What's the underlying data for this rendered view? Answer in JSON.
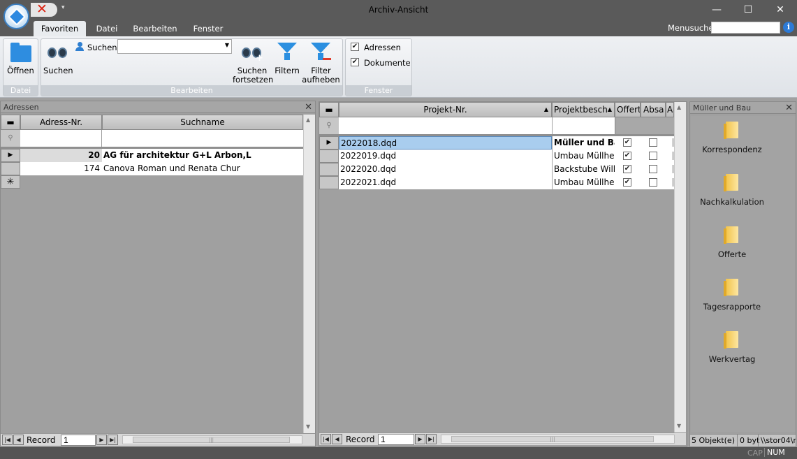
{
  "window": {
    "title": "Archiv-Ansicht",
    "minimize": "—",
    "maximize": "☐",
    "close": "✕"
  },
  "tabs": [
    {
      "label": "Favoriten",
      "active": true
    },
    {
      "label": "Datei"
    },
    {
      "label": "Bearbeiten"
    },
    {
      "label": "Fenster"
    }
  ],
  "menusuche": {
    "label": "Menusuche",
    "value": ""
  },
  "ribbon": {
    "groups": {
      "datei": "Datei",
      "bearbeiten": "Bearbeiten",
      "fenster": "Fenster"
    },
    "oeffnen": "Öffnen",
    "suchen": "Suchen",
    "suchen_field_label": "Suchen",
    "suchen_field_value": "",
    "suchen_fortsetzen_1": "Suchen",
    "suchen_fortsetzen_2": "fortsetzen",
    "filtern": "Filtern",
    "filter_aufheben_1": "Filter",
    "filter_aufheben_2": "aufheben",
    "chk_adressen": {
      "label": "Adressen",
      "checked": true
    },
    "chk_dokumente": {
      "label": "Dokumente",
      "checked": true
    }
  },
  "adressen_panel": {
    "title": "Adressen",
    "columns": [
      "Adress-Nr.",
      "Suchname"
    ],
    "rows": [
      {
        "nr": "20",
        "name": "AG für architektur G+L Arbon,L",
        "current": true
      },
      {
        "nr": "174",
        "name": "Canova Roman und Renata Chur",
        "current": false
      }
    ],
    "nav": {
      "record_label": "Record",
      "record_value": "1"
    }
  },
  "projekte_panel": {
    "columns": [
      "Projekt-Nr.",
      "Projektbesch",
      "Offert",
      "Absa",
      "A"
    ],
    "rows": [
      {
        "nr": "2022018.dqd",
        "desc": "Müller und Ba",
        "offert": true,
        "absa": false,
        "current": true
      },
      {
        "nr": "2022019.dqd",
        "desc": "Umbau Müllhei",
        "offert": true,
        "absa": false
      },
      {
        "nr": "2022020.dqd",
        "desc": "Backstube Willi",
        "offert": true,
        "absa": false
      },
      {
        "nr": "2022021.dqd",
        "desc": "Umbau Müllhei",
        "offert": true,
        "absa": false
      }
    ],
    "nav": {
      "record_label": "Record",
      "record_value": "1"
    }
  },
  "explorer_panel": {
    "title": "Müller und Bau",
    "items": [
      "Korrespondenz",
      "Nachkalkulation",
      "Offerte",
      "Tagesrapporte",
      "Werkvertag"
    ],
    "status": [
      "5 Objekt(e)",
      "0 byt",
      "\\\\stor04\\r"
    ]
  },
  "statusbar": {
    "cap": "CAP",
    "num": "NUM"
  }
}
